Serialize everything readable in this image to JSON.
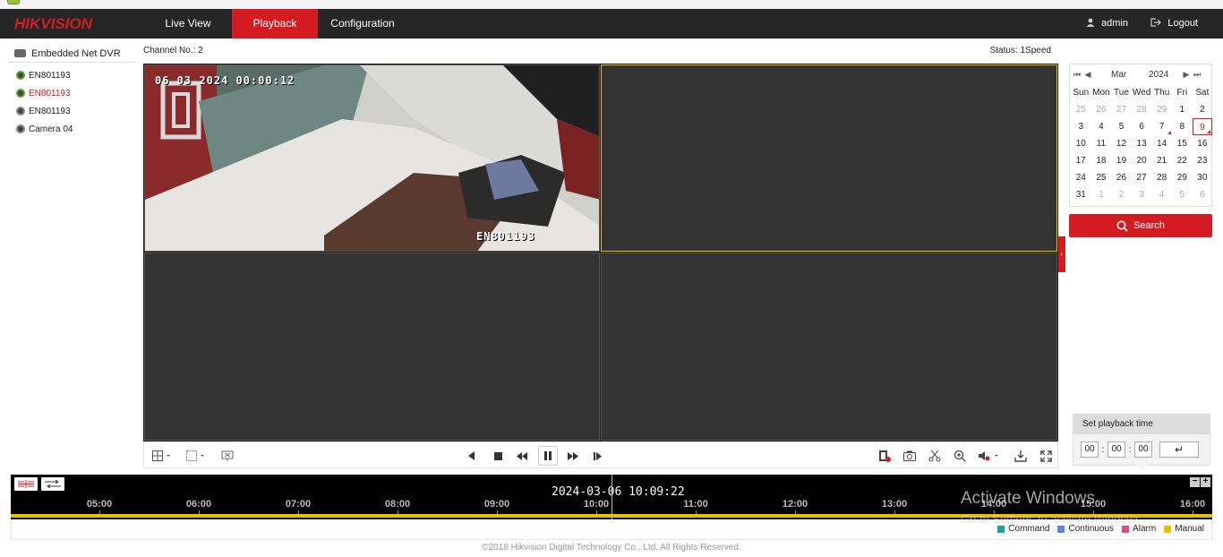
{
  "app": {
    "brand": "HIKVISION"
  },
  "nav": {
    "tabs": [
      {
        "label": "Live View"
      },
      {
        "label": "Playback"
      },
      {
        "label": "Configuration"
      }
    ],
    "active": "Playback"
  },
  "user": {
    "name": "admin",
    "logout": "Logout"
  },
  "sidebar": {
    "device": "Embedded Net DVR",
    "cameras": [
      {
        "label": "EN801193",
        "selected": false
      },
      {
        "label": "EN801193",
        "selected": true
      },
      {
        "label": "EN801193",
        "selected": false
      },
      {
        "label": "Camera 04",
        "selected": false
      }
    ]
  },
  "main": {
    "channel": "Channel No.: 2",
    "status": "Status: 1Speed"
  },
  "video": {
    "osd_time": "06 03 2024 00:00:12",
    "osd_name": "EN801193"
  },
  "calendar": {
    "month": "Mar",
    "year": "2024",
    "weekdays": [
      "Sun",
      "Mon",
      "Tue",
      "Wed",
      "Thu",
      "Fri",
      "Sat"
    ],
    "days": [
      "25",
      "26",
      "27",
      "28",
      "29",
      "1",
      "2",
      "3",
      "4",
      "5",
      "6",
      "7",
      "8",
      "9",
      "10",
      "11",
      "12",
      "13",
      "14",
      "15",
      "16",
      "17",
      "18",
      "19",
      "20",
      "21",
      "22",
      "23",
      "24",
      "25",
      "26",
      "27",
      "28",
      "29",
      "30",
      "31",
      "1",
      "2",
      "3",
      "4",
      "5",
      "6"
    ],
    "selected": "6"
  },
  "search": {
    "label": "Search"
  },
  "playback_time": {
    "title": "Set playback time",
    "hh": "00",
    "mm": "00",
    "ss": "00",
    "ok_icon": "enter-icon"
  },
  "timeline": {
    "current": "2024-03-06 10:09:22",
    "ticks": [
      "05:00",
      "06:00",
      "07:00",
      "08:00",
      "09:00",
      "10:00",
      "11:00",
      "12:00",
      "13:00",
      "14:00",
      "15:00",
      "16:00"
    ]
  },
  "legend": [
    {
      "label": "Command",
      "color": "#1aa59a"
    },
    {
      "label": "Continuous",
      "color": "#5b82e6"
    },
    {
      "label": "Alarm",
      "color": "#e04b7a"
    },
    {
      "label": "Manual",
      "color": "#e8c000"
    }
  ],
  "watermark": {
    "line1": "Activate Windows",
    "line2": "Go to Settings to activate Windows."
  },
  "footer": "©2018 Hikvision Digital Technology Co., Ltd. All Rights Reserved."
}
